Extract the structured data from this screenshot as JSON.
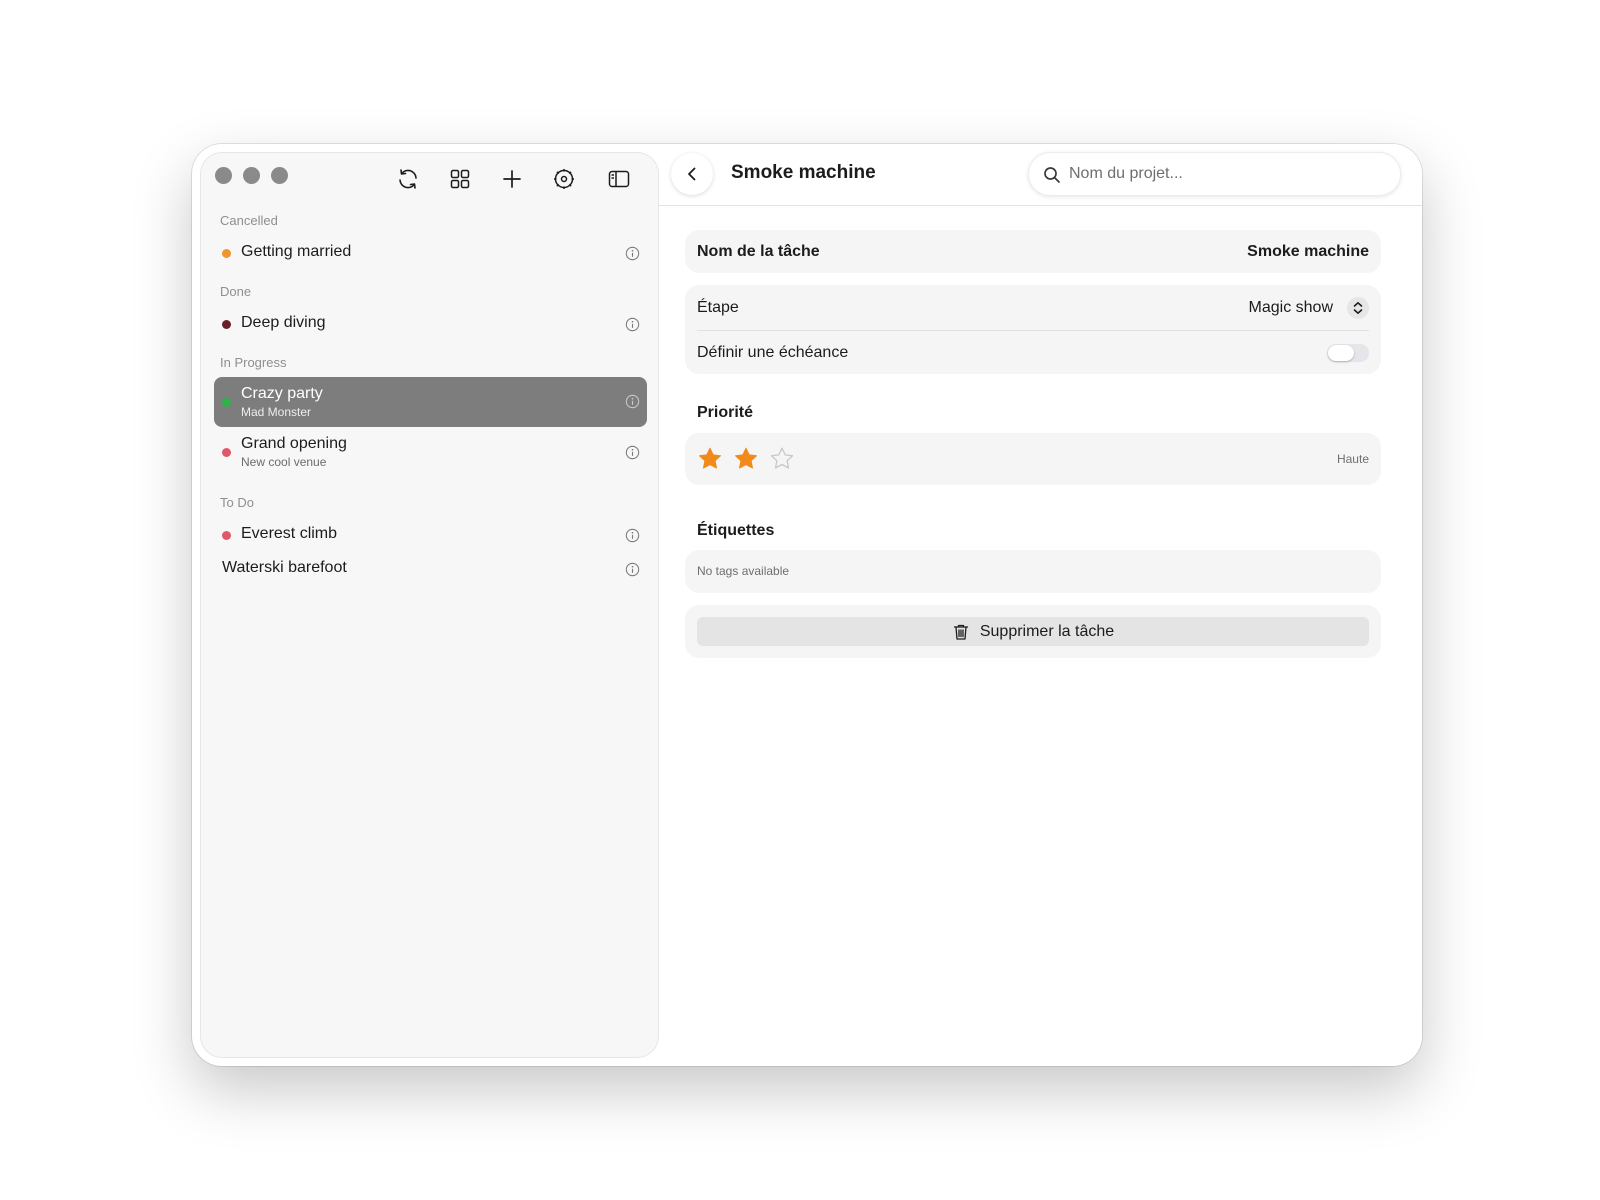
{
  "sidebar": {
    "groups": [
      {
        "label": "Cancelled",
        "items": [
          {
            "title": "Getting married",
            "subtitle": "",
            "dot_color": "#f0952f"
          }
        ]
      },
      {
        "label": "Done",
        "items": [
          {
            "title": "Deep diving",
            "subtitle": "",
            "dot_color": "#6b1f28"
          }
        ]
      },
      {
        "label": "In Progress",
        "items": [
          {
            "title": "Crazy party",
            "subtitle": "Mad Monster",
            "dot_color": "#2fb24a",
            "selected": true
          },
          {
            "title": "Grand opening",
            "subtitle": "New cool venue",
            "dot_color": "#e0566a"
          }
        ]
      },
      {
        "label": "To Do",
        "items": [
          {
            "title": "Everest climb",
            "subtitle": "",
            "dot_color": "#e0566a"
          },
          {
            "title": "Waterski barefoot",
            "subtitle": ""
          }
        ]
      }
    ],
    "toolbar_icons": [
      "sync-icon",
      "grid-icon",
      "plus-icon",
      "settings-icon",
      "sidebar-toggle-icon"
    ]
  },
  "header": {
    "title": "Smoke machine",
    "search_placeholder": "Nom du projet..."
  },
  "detail": {
    "task_name_label": "Nom de la tâche",
    "task_name_value": "Smoke machine",
    "stage_label": "Étape",
    "stage_value": "Magic show",
    "deadline_label": "Définir une échéance",
    "deadline_enabled": false,
    "priority_title": "Priorité",
    "priority_rating": 2,
    "priority_max": 3,
    "priority_level": "Haute",
    "tags_title": "Étiquettes",
    "tags_empty": "No tags available",
    "delete_label": "Supprimer la tâche"
  },
  "colors": {
    "star": "#f28a1b",
    "selected_row": "#7d7d7d"
  }
}
